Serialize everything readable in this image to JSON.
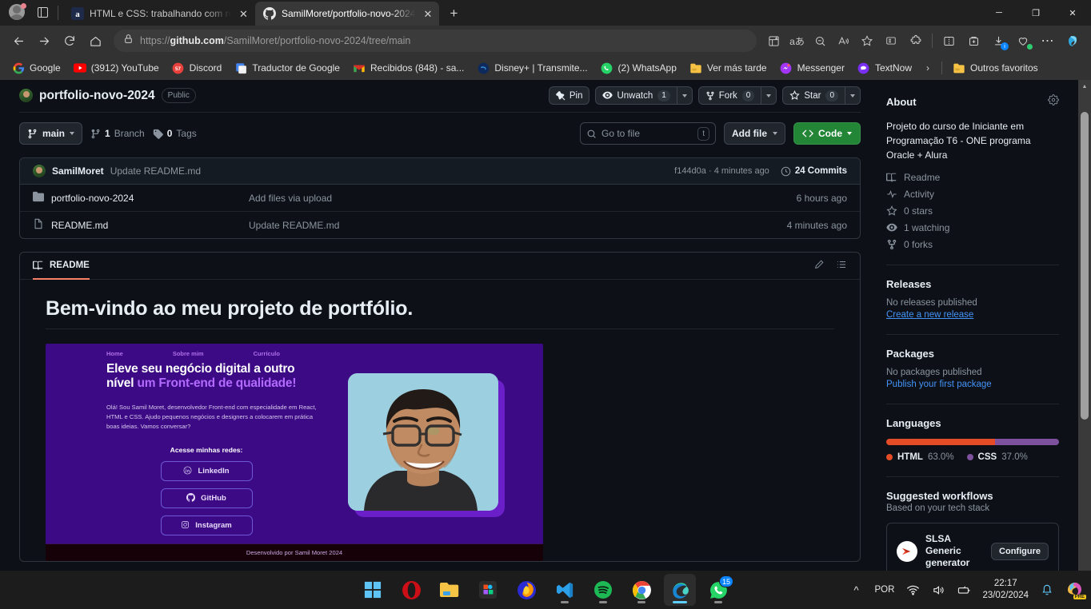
{
  "browser": {
    "tabs": [
      {
        "title": "HTML e CSS: trabalhando com re",
        "active": false,
        "favicon": "alura-icon"
      },
      {
        "title": "SamilMoret/portfolio-novo-2024",
        "active": true,
        "favicon": "github-icon"
      }
    ],
    "new_tab_label": "+",
    "url_scheme": "https://",
    "url_domain": "github.com",
    "url_path": "/SamilMoret/portfolio-novo-2024/tree/main",
    "window_controls": {
      "minimize": "─",
      "maximize": "❐",
      "close": "✕"
    },
    "bookmarks": [
      {
        "label": "Google",
        "icon": "google-icon"
      },
      {
        "label": "(3912) YouTube",
        "icon": "youtube-icon"
      },
      {
        "label": "Discord",
        "icon": "discord-icon"
      },
      {
        "label": "Traductor de Google",
        "icon": "translate-icon"
      },
      {
        "label": "Recibidos (848) - sa...",
        "icon": "gmail-icon"
      },
      {
        "label": "Disney+ | Transmite...",
        "icon": "disney-icon"
      },
      {
        "label": "(2) WhatsApp",
        "icon": "whatsapp-icon"
      },
      {
        "label": "Ver más tarde",
        "icon": "folder-icon"
      },
      {
        "label": "Messenger",
        "icon": "messenger-icon"
      },
      {
        "label": "TextNow",
        "icon": "textnow-icon"
      }
    ],
    "bookmarks_overflow": "›",
    "other_favorites": {
      "label": "Outros favoritos",
      "icon": "folder-icon"
    }
  },
  "repo": {
    "name": "portfolio-novo-2024",
    "visibility": "Public",
    "actions": {
      "pin": "Pin",
      "unwatch": "Unwatch",
      "unwatch_count": "1",
      "fork": "Fork",
      "fork_count": "0",
      "star": "Star",
      "star_count": "0"
    },
    "branch": "main",
    "branches": "1",
    "branches_label": "Branch",
    "tags": "0",
    "tags_label": "Tags",
    "go_to_file_placeholder": "Go to file",
    "go_to_file_kbd": "t",
    "add_file": "Add file",
    "code": "Code"
  },
  "commit": {
    "author": "SamilMoret",
    "message": "Update README.md",
    "sha": "f144d0a",
    "time": "4 minutes ago",
    "separator": "·",
    "commits_count": "24 Commits"
  },
  "files": [
    {
      "icon": "folder-icon",
      "name": "portfolio-novo-2024",
      "message": "Add files via upload",
      "time": "6 hours ago"
    },
    {
      "icon": "file-icon",
      "name": "README.md",
      "message": "Update README.md",
      "time": "4 minutes ago"
    }
  ],
  "readme": {
    "tab_label": "README",
    "edit_icon": "pencil-icon",
    "outline_icon": "list-icon",
    "heading": "Bem-vindo ao meu projeto de portfólio.",
    "screenshot": {
      "nav": [
        "Home",
        "Sobre mim",
        "Currículo"
      ],
      "title_part1": "Eleve seu negócio digital a outro nível ",
      "title_part2": "um Front-end de qualidade!",
      "paragraph": "Olá! Sou Samil Moret, desenvolvedor Front-end com especialidade em React, HTML e CSS. Ajudo pequenos negócios e designers a colocarem em prática boas ideias. Vamos conversar?",
      "redes_label": "Acesse minhas redes:",
      "buttons": [
        {
          "label": "LinkedIn",
          "icon": "linkedin-icon"
        },
        {
          "label": "GitHub",
          "icon": "github-icon"
        },
        {
          "label": "Instagram",
          "icon": "instagram-icon"
        }
      ],
      "footer": "Desenvolvido por Samil Moret 2024",
      "bg_color": "#3b0a84",
      "accent_color": "#b36aff"
    }
  },
  "sidebar": {
    "about_title": "About",
    "settings_icon": "gear-icon",
    "description": "Projeto do curso de Iniciante em Programação T6 - ONE programa Oracle + Alura",
    "items": [
      {
        "label": "Readme",
        "icon": "book-icon"
      },
      {
        "label": "Activity",
        "icon": "pulse-icon"
      },
      {
        "label": "0 stars",
        "icon": "star-icon"
      },
      {
        "label": "1 watching",
        "icon": "eye-icon"
      },
      {
        "label": "0 forks",
        "icon": "fork-icon"
      }
    ],
    "releases": {
      "title": "Releases",
      "empty": "No releases published",
      "link": "Create a new release"
    },
    "packages": {
      "title": "Packages",
      "empty": "No packages published",
      "link": "Publish your first package"
    },
    "languages": {
      "title": "Languages",
      "items": [
        {
          "name": "HTML",
          "pct": "63.0%",
          "value": 63.0,
          "color": "#e34c26"
        },
        {
          "name": "CSS",
          "pct": "37.0%",
          "value": 37.0,
          "color": "#7d519e"
        }
      ]
    },
    "workflows": {
      "title": "Suggested workflows",
      "subtitle": "Based on your tech stack",
      "card_name": "SLSA Generic generator",
      "card_button": "Configure"
    }
  },
  "taskbar": {
    "items": [
      {
        "name": "start-button",
        "icon": "windows-icon",
        "running": false,
        "active": false
      },
      {
        "name": "opera",
        "icon": "opera-icon",
        "running": false,
        "active": false
      },
      {
        "name": "file-explorer",
        "icon": "folder-icon",
        "running": false,
        "active": false
      },
      {
        "name": "figma",
        "icon": "figma-icon",
        "running": false,
        "active": false
      },
      {
        "name": "firefox",
        "icon": "firefox-icon",
        "running": false,
        "active": false
      },
      {
        "name": "vscode",
        "icon": "vscode-icon",
        "running": true,
        "active": false
      },
      {
        "name": "spotify",
        "icon": "spotify-icon",
        "running": true,
        "active": false
      },
      {
        "name": "chrome",
        "icon": "chrome-icon",
        "running": true,
        "active": false
      },
      {
        "name": "edge",
        "icon": "edge-icon",
        "running": true,
        "active": true
      },
      {
        "name": "whatsapp",
        "icon": "whatsapp-icon",
        "running": true,
        "active": false,
        "badge": "15"
      }
    ],
    "tray": {
      "overflow": "⌃",
      "language": "POR",
      "wifi": "wifi-icon",
      "volume": "volume-icon",
      "battery": "battery-icon",
      "time": "22:17",
      "date": "23/02/2024",
      "notifications": "bell-icon",
      "copilot": "copilot-icon",
      "copilot_badge": "PRE"
    }
  }
}
